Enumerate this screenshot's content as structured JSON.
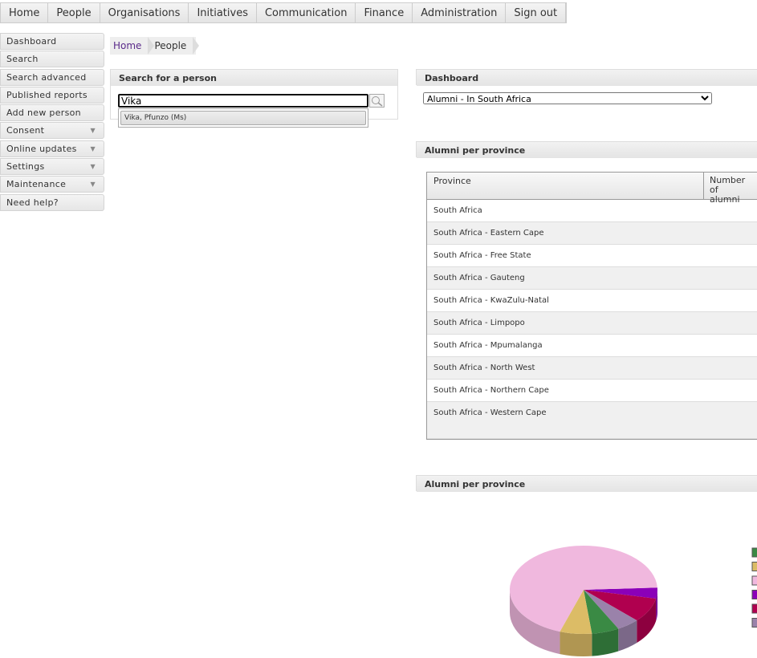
{
  "topnav": [
    "Home",
    "People",
    "Organisations",
    "Initiatives",
    "Communication",
    "Finance",
    "Administration",
    "Sign out"
  ],
  "sidebar": [
    {
      "label": "Dashboard"
    },
    {
      "label": "Search"
    },
    {
      "label": "Search advanced"
    },
    {
      "label": "Published reports"
    },
    {
      "label": "Add new person"
    },
    {
      "label": "Consent",
      "menu": true
    },
    {
      "label": "Online updates",
      "menu": true
    },
    {
      "label": "Settings",
      "menu": true
    },
    {
      "label": "Maintenance",
      "menu": true
    },
    {
      "label": "Need help?"
    }
  ],
  "breadcrumb": [
    "Home",
    "People"
  ],
  "search": {
    "title": "Search for a person",
    "value": "Vika",
    "suggestion": "Vika, Pfunzo (Ms)"
  },
  "dashboard": {
    "title": "Dashboard",
    "selected": "Alumni - In South Africa"
  },
  "table": {
    "title": "Alumni per province",
    "headers": [
      "Province",
      "Number of alumni"
    ],
    "rows": [
      "South Africa",
      "South Africa - Eastern Cape",
      "South Africa - Free State",
      "South Africa - Gauteng",
      "South Africa - KwaZulu-Natal",
      "South Africa - Limpopo",
      "South Africa - Mpumalanga",
      "South Africa - North West",
      "South Africa - Northern Cape",
      "South Africa - Western Cape"
    ]
  },
  "chart_data": {
    "type": "pie",
    "title": "Alumni per province",
    "slices": [
      {
        "color": "#8b00b8",
        "value": 4
      },
      {
        "color": "#b0004f",
        "value": 9
      },
      {
        "color": "#9a82aa",
        "value": 5
      },
      {
        "color": "#3a8a44",
        "value": 6
      },
      {
        "color": "#dcbc66",
        "value": 7
      },
      {
        "color": "#f0b8de",
        "value": 69
      }
    ],
    "legend_colors": [
      "#3a8a44",
      "#dcbc66",
      "#f0b8de",
      "#8b00b8",
      "#b0004f",
      "#9a82aa"
    ]
  }
}
